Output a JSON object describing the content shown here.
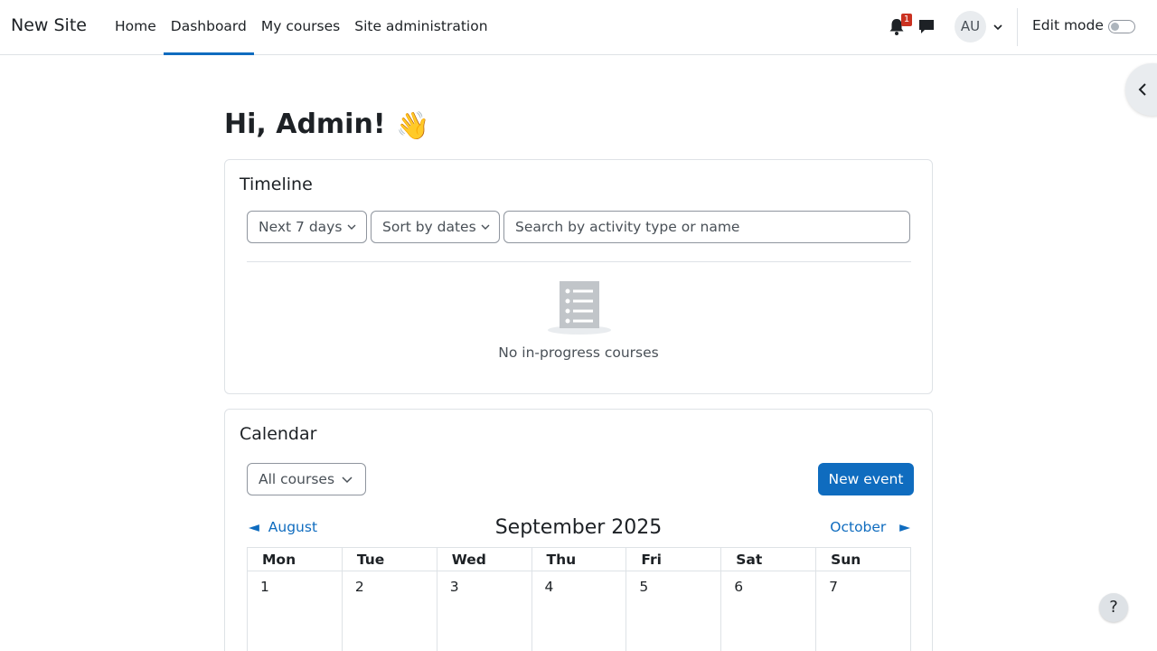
{
  "navbar": {
    "brand": "New Site",
    "items": [
      {
        "label": "Home",
        "active": false
      },
      {
        "label": "Dashboard",
        "active": true
      },
      {
        "label": "My courses",
        "active": false
      },
      {
        "label": "Site administration",
        "active": false
      }
    ],
    "notification_count": "1",
    "avatar_initials": "AU",
    "edit_mode_label": "Edit mode",
    "edit_mode_on": false,
    "accent_color": "#0f6cbf"
  },
  "greeting": {
    "text": "Hi, Admin!",
    "emoji": "👋"
  },
  "timeline": {
    "title": "Timeline",
    "range_select": "Next 7 days",
    "sort_select": "Sort by dates",
    "search_placeholder": "Search by activity type or name",
    "empty_message": "No in-progress courses",
    "empty_icon": "list-document-icon"
  },
  "calendar": {
    "title": "Calendar",
    "course_select": "All courses",
    "new_event_label": "New event",
    "prev_month": "August",
    "current_month": "September 2025",
    "next_month": "October",
    "weekdays": [
      "Mon",
      "Tue",
      "Wed",
      "Thu",
      "Fri",
      "Sat",
      "Sun"
    ],
    "first_week": [
      "1",
      "2",
      "3",
      "4",
      "5",
      "6",
      "7"
    ]
  },
  "help": {
    "label": "?"
  }
}
